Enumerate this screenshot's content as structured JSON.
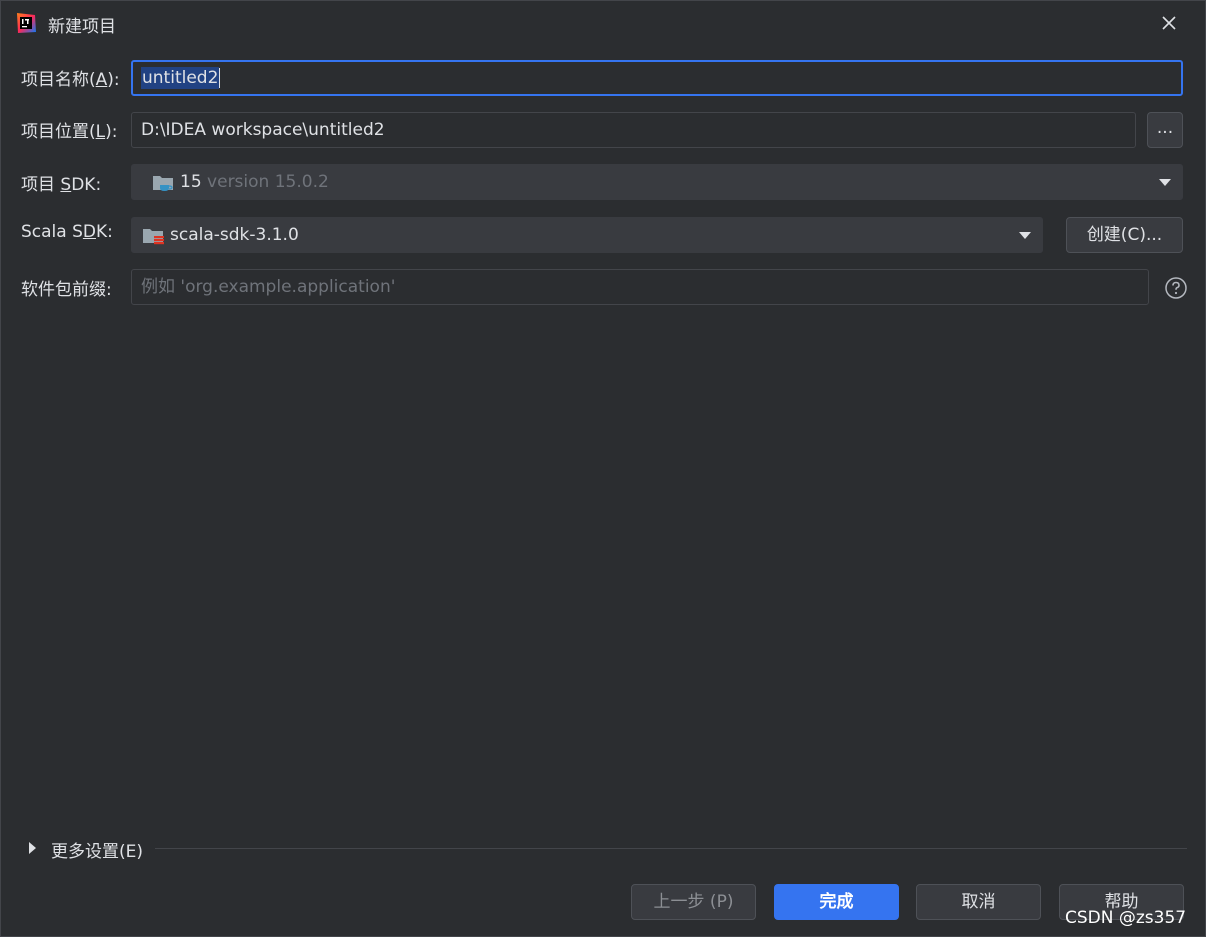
{
  "window": {
    "title": "新建项目"
  },
  "form": {
    "name_label_pre": "项目名称(",
    "name_label_key": "A",
    "name_label_post": "):",
    "name_value": "untitled2",
    "location_label_pre": "项目位置(",
    "location_label_key": "L",
    "location_label_post": "):",
    "location_value": "D:\\IDEA workspace\\untitled2",
    "browse_label": "...",
    "sdk_label_pre": "项目 ",
    "sdk_label_key": "S",
    "sdk_label_post": "DK:",
    "sdk_version": "15",
    "sdk_detail": "version 15.0.2",
    "scala_label_pre": "Scala S",
    "scala_label_key": "D",
    "scala_label_post": "K:",
    "scala_value": "scala-sdk-3.1.0",
    "create_label": "创建(C)...",
    "package_label": "软件包前缀:",
    "package_placeholder": "例如 'org.example.application'"
  },
  "more_settings_label": "更多设置(E)",
  "footer": {
    "prev_label": "上一步 (P)",
    "finish_label": "完成",
    "cancel_label": "取消",
    "help_label": "帮助"
  },
  "watermark": "CSDN @zs357",
  "icons": {
    "app": "intellij-idea-icon",
    "close": "close-icon",
    "jdk": "jdk-folder-icon",
    "scala": "scala-folder-icon",
    "help": "question-icon",
    "expand": "triangle-right-icon"
  },
  "colors": {
    "background": "#2b2d30",
    "accent": "#3574f0",
    "combo": "#393b40",
    "border": "#43454a",
    "text": "#dfe1e5",
    "placeholder": "#6f737a"
  }
}
